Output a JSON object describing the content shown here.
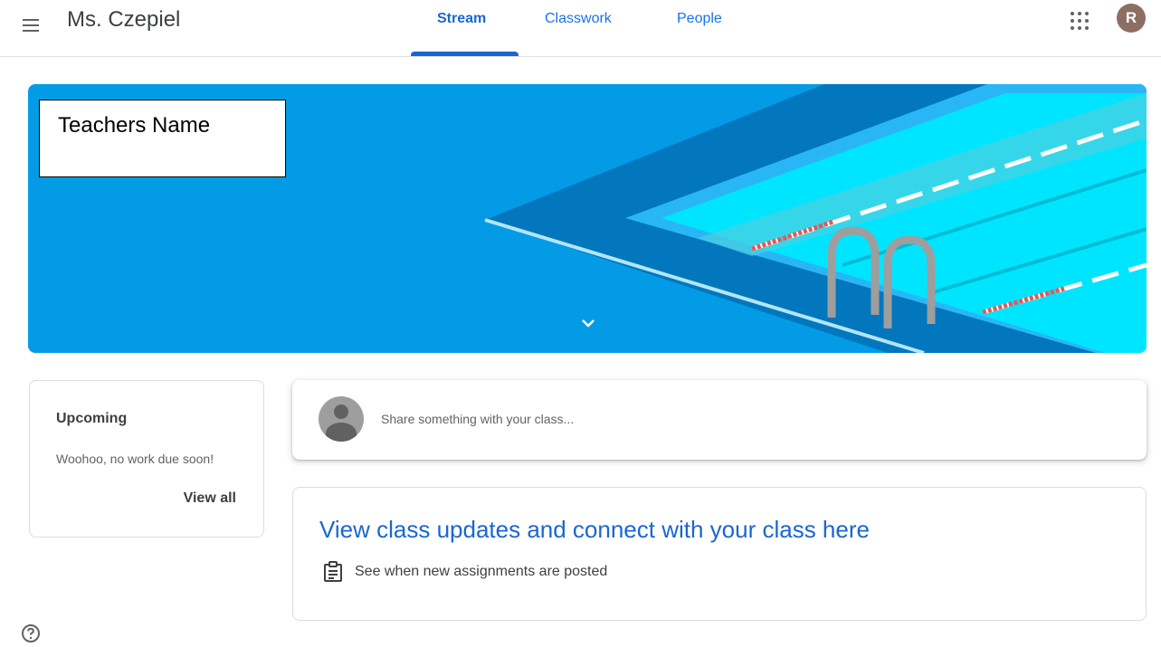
{
  "header": {
    "class_title": "Ms. Czepiel",
    "tabs": [
      {
        "label": "Stream",
        "active": true
      },
      {
        "label": "Classwork",
        "active": false
      },
      {
        "label": "People",
        "active": false
      }
    ],
    "avatar_initial": "R",
    "icons": {
      "menu": "hamburger-menu-icon",
      "apps": "google-apps-icon"
    }
  },
  "banner": {
    "name_box_text": "Teachers Name",
    "theme": "swimming-pool",
    "accent_color": "#039be5"
  },
  "upcoming": {
    "title": "Upcoming",
    "empty_text": "Woohoo, no work due soon!",
    "view_all": "View all"
  },
  "share": {
    "placeholder": "Share something with your class..."
  },
  "updates": {
    "title": "View class updates and connect with your class here",
    "items": [
      {
        "icon": "assignment-icon",
        "text": "See when new assignments are posted"
      }
    ]
  },
  "colors": {
    "primary": "#1967d2",
    "link": "#1a73e8",
    "avatar_bg": "#8d6e63"
  }
}
